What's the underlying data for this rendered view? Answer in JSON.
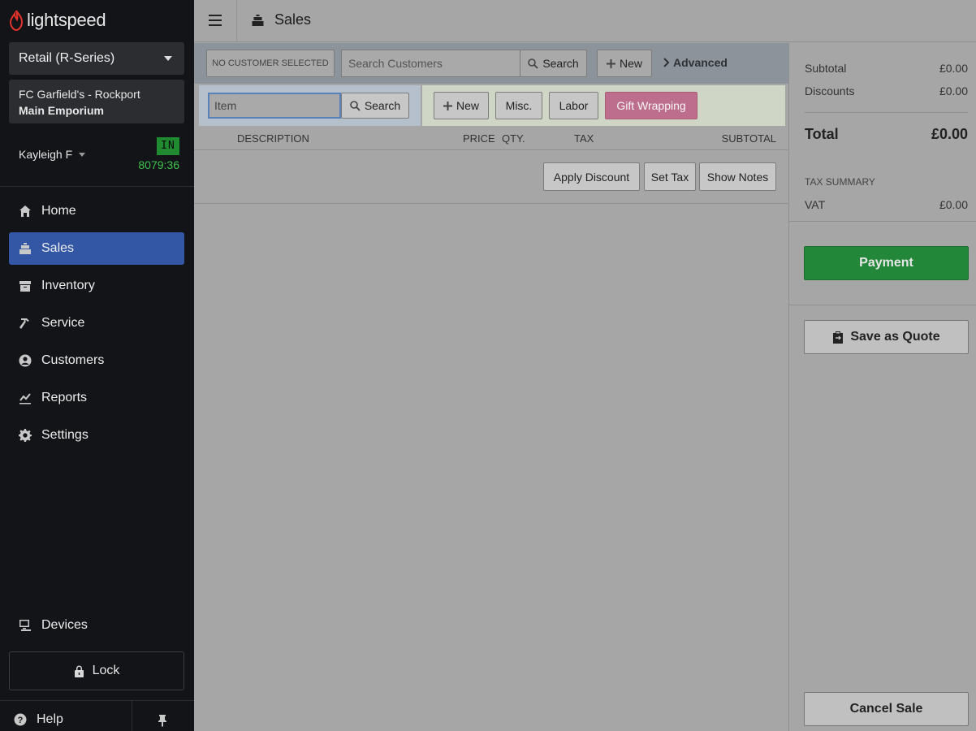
{
  "brand": {
    "name": "lightspeed",
    "accent": "#e2332b"
  },
  "sidebar": {
    "shop_selector": "Retail (R-Series)",
    "store_line1": "FC Garfield's - Rockport",
    "store_line2": "Main Emporium",
    "user": "Kayleigh F",
    "clock_status": "IN",
    "clock_time": "8079:36",
    "nav": [
      {
        "label": "Home",
        "icon": "home-icon"
      },
      {
        "label": "Sales",
        "icon": "register-icon",
        "active": true
      },
      {
        "label": "Inventory",
        "icon": "inventory-icon"
      },
      {
        "label": "Service",
        "icon": "hammer-icon"
      },
      {
        "label": "Customers",
        "icon": "user-circle-icon"
      },
      {
        "label": "Reports",
        "icon": "chart-icon"
      },
      {
        "label": "Settings",
        "icon": "gear-icon"
      }
    ],
    "devices": "Devices",
    "lock": "Lock",
    "help": "Help",
    "active_color": "#3457a5"
  },
  "topbar": {
    "title": "Sales"
  },
  "customer_bar": {
    "no_customer": "NO CUSTOMER SELECTED",
    "search_placeholder": "Search Customers",
    "search_label": "Search",
    "new_label": "New",
    "advanced_label": "Advanced"
  },
  "item_bar": {
    "item_placeholder": "Item",
    "search_label": "Search",
    "new_label": "New",
    "misc_label": "Misc.",
    "labor_label": "Labor",
    "gift_label": "Gift Wrapping"
  },
  "table": {
    "columns": [
      "DESCRIPTION",
      "PRICE",
      "QTY.",
      "TAX",
      "SUBTOTAL"
    ]
  },
  "actions": {
    "apply_discount": "Apply Discount",
    "set_tax": "Set Tax",
    "show_notes": "Show Notes"
  },
  "summary": {
    "subtotal_label": "Subtotal",
    "subtotal_value": "£0.00",
    "discounts_label": "Discounts",
    "discounts_value": "£0.00",
    "total_label": "Total",
    "total_value": "£0.00",
    "tax_summary_label": "TAX SUMMARY",
    "vat_label": "VAT",
    "vat_value": "£0.00"
  },
  "buttons": {
    "payment": "Payment",
    "save_quote": "Save as Quote",
    "cancel_sale": "Cancel Sale",
    "payment_color": "#23873a"
  }
}
